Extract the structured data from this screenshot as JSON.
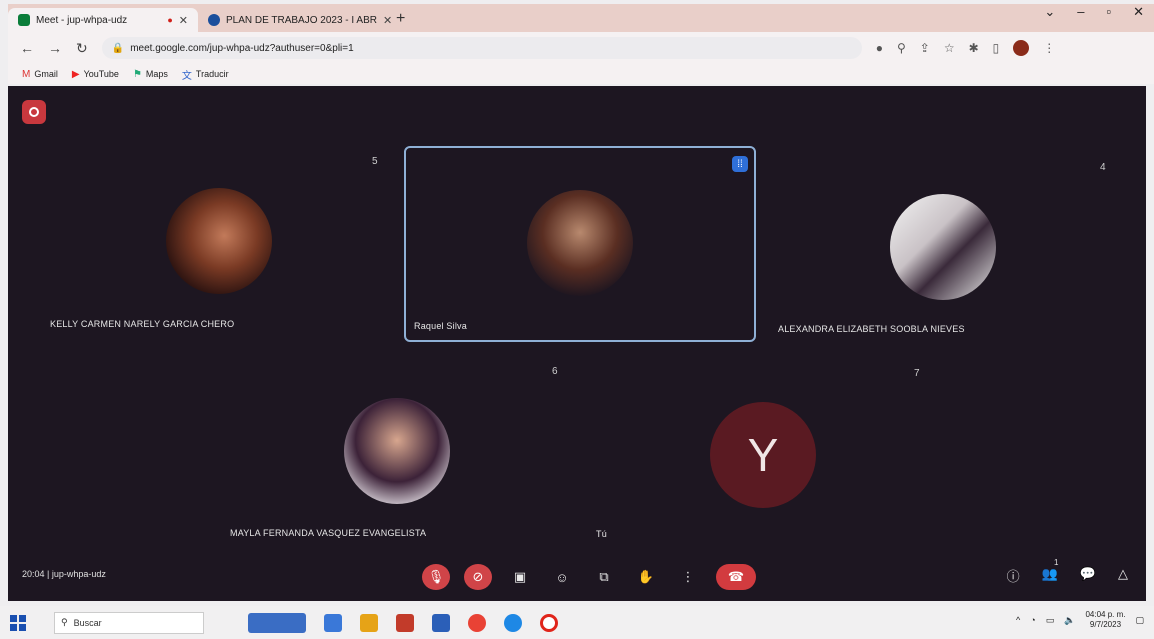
{
  "browser": {
    "tabs": [
      {
        "label": "Meet - jup-whpa-udz",
        "active": true
      },
      {
        "label": "PLAN DE TRABAJO 2023 - I ABR",
        "active": false
      }
    ],
    "new_tab": "+",
    "url": "meet.google.com/jup-whpa-udz?authuser=0&pli=1",
    "bookmarks": [
      {
        "label": "Gmail",
        "icon": "gmail-icon"
      },
      {
        "label": "YouTube",
        "icon": "youtube-icon"
      },
      {
        "label": "Maps",
        "icon": "maps-icon"
      },
      {
        "label": "Traducir",
        "icon": "translate-icon"
      }
    ]
  },
  "meet": {
    "tiles": [
      {
        "number": "5",
        "name": "KELLY CARMEN NARELY GARCIA CHERO",
        "pinned": false
      },
      {
        "number": "",
        "name": "Raquel Silva",
        "pinned": true
      },
      {
        "number": "4",
        "name": "ALEXANDRA ELIZABETH SOOBLA NIEVES",
        "pinned": false
      },
      {
        "number": "6",
        "name": "MAYLA FERNANDA VASQUEZ EVANGELISTA",
        "pinned": false
      },
      {
        "number": "7",
        "name": "Tú",
        "initial": "Y",
        "pinned": false
      }
    ],
    "meeting_info": "20:04  |  jup-whpa-udz",
    "people_count": "1",
    "colors": {
      "stage": "#1d1621",
      "accent_red": "#d04448",
      "active_border": "#8fb0d6",
      "self_avatar": "#5a1a22"
    }
  },
  "taskbar": {
    "search_placeholder": "Buscar",
    "time": "04:04 p. m.",
    "date": "9/7/2023"
  }
}
